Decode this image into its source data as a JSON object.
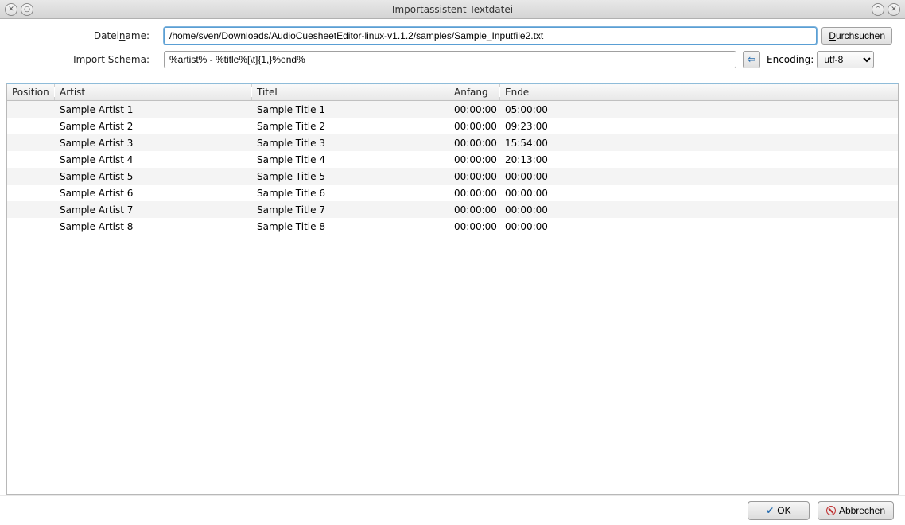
{
  "window": {
    "title": "Importassistent Textdatei"
  },
  "form": {
    "filename_label_pre": "Datei",
    "filename_label_ul": "n",
    "filename_label_post": "ame:",
    "filename_value": "/home/sven/Downloads/AudioCuesheetEditor-linux-v1.1.2/samples/Sample_Inputfile2.txt",
    "browse_ul": "D",
    "browse_rest": "urchsuchen",
    "schema_label_ul": "I",
    "schema_label_rest": "mport Schema:",
    "schema_value": "%artist% - %title%[\\t]{1,}%end%",
    "encoding_label": "Encoding:",
    "encoding_value": "utf-8"
  },
  "table": {
    "headers": {
      "position": "Position",
      "artist": "Artist",
      "title": "Titel",
      "anfang": "Anfang",
      "ende": "Ende"
    },
    "rows": [
      {
        "position": "",
        "artist": "Sample Artist 1",
        "title": "Sample Title 1",
        "anfang": "00:00:00",
        "ende": "05:00:00"
      },
      {
        "position": "",
        "artist": "Sample Artist 2",
        "title": "Sample Title 2",
        "anfang": "00:00:00",
        "ende": "09:23:00"
      },
      {
        "position": "",
        "artist": "Sample Artist 3",
        "title": "Sample Title 3",
        "anfang": "00:00:00",
        "ende": "15:54:00"
      },
      {
        "position": "",
        "artist": "Sample Artist 4",
        "title": "Sample Title 4",
        "anfang": "00:00:00",
        "ende": "20:13:00"
      },
      {
        "position": "",
        "artist": "Sample Artist 5",
        "title": "Sample Title 5",
        "anfang": "00:00:00",
        "ende": "00:00:00"
      },
      {
        "position": "",
        "artist": "Sample Artist 6",
        "title": "Sample Title 6",
        "anfang": "00:00:00",
        "ende": "00:00:00"
      },
      {
        "position": "",
        "artist": "Sample Artist 7",
        "title": "Sample Title 7",
        "anfang": "00:00:00",
        "ende": "00:00:00"
      },
      {
        "position": "",
        "artist": "Sample Artist 8",
        "title": "Sample Title 8",
        "anfang": "00:00:00",
        "ende": "00:00:00"
      }
    ]
  },
  "buttons": {
    "ok_ul": "O",
    "ok_rest": "K",
    "cancel_ul": "A",
    "cancel_rest": "bbrechen"
  }
}
